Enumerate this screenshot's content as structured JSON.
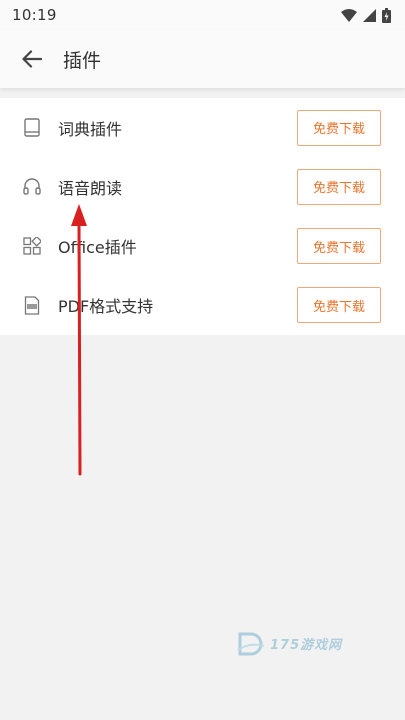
{
  "status_bar": {
    "time": "10:19",
    "icons": [
      "wifi-icon",
      "signal-icon",
      "battery-icon"
    ]
  },
  "app_bar": {
    "back_icon": "back-arrow-icon",
    "title": "插件"
  },
  "plugins": [
    {
      "icon": "book-icon",
      "name": "词典插件",
      "button": "免费下载"
    },
    {
      "icon": "headphones-icon",
      "name": "语音朗读",
      "button": "免费下载"
    },
    {
      "icon": "grid-icon",
      "name": "Office插件",
      "button": "免费下载"
    },
    {
      "icon": "pdf-icon",
      "name": "PDF格式支持",
      "button": "免费下载"
    }
  ],
  "watermark": {
    "text": "175游戏网"
  },
  "colors": {
    "accent": "#e8752e",
    "accent_border": "#f0a878",
    "annotation_arrow": "#d92020"
  }
}
